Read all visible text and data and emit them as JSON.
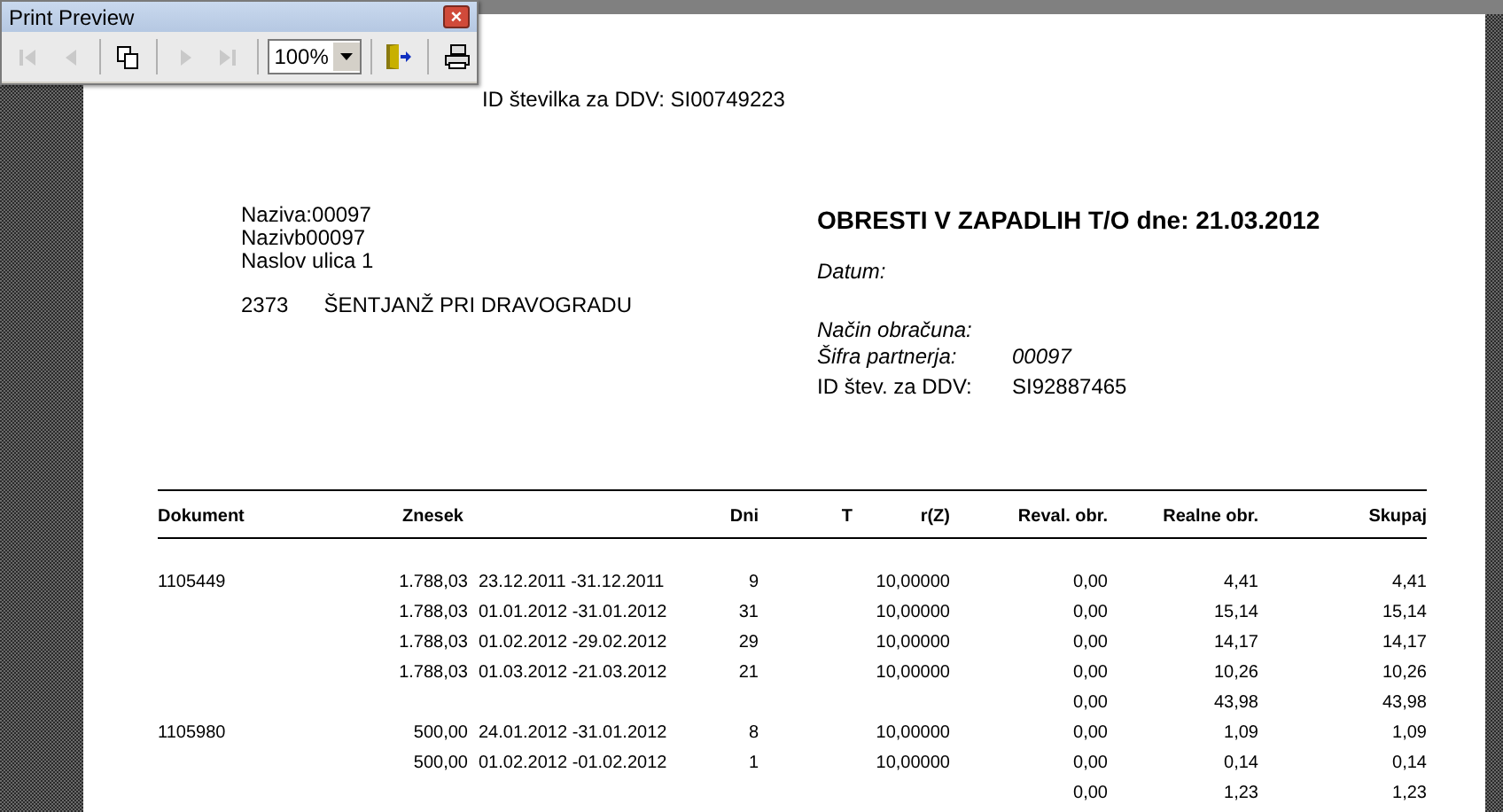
{
  "toolbar_window": {
    "title": "Print Preview",
    "close": "×",
    "tools": [
      {
        "kind": "first",
        "disabled": true
      },
      {
        "kind": "prev",
        "disabled": true
      },
      {
        "kind": "pages",
        "disabled": false
      },
      {
        "kind": "next",
        "disabled": true
      },
      {
        "kind": "last",
        "disabled": true
      },
      {
        "kind": "zoom",
        "value": "100%"
      },
      {
        "kind": "exit",
        "disabled": false
      },
      {
        "kind": "print",
        "disabled": false
      }
    ]
  },
  "report": {
    "id_line": "ID številka za DDV: SI00749223",
    "address": [
      "Naziva:00097",
      "Nazivb00097",
      "Naslov ulica 1"
    ],
    "post_code": "2373",
    "city": "ŠENTJANŽ PRI DRAVOGRADU",
    "title": "OBRESTI V ZAPADLIH T/O dne: 21.03.2012",
    "date_label": "Datum:",
    "method_label": "Način obračuna:",
    "partner_label": "Šifra partnerja:",
    "partner_value": "00097",
    "vat_label": "ID štev. za DDV:",
    "vat_value": "SI92887465"
  },
  "table": {
    "columns": [
      "Dokument",
      "Znesek",
      "",
      "Dni",
      "T",
      "r(Z)",
      "Reval. obr.",
      "Realne obr.",
      "Skupaj"
    ],
    "rows": [
      {
        "cells": [
          "1105449",
          "1.788,03",
          "23.12.2011 -31.12.2011",
          "9",
          "",
          "10,00000",
          "0,00",
          "4,41",
          "4,41"
        ]
      },
      {
        "cells": [
          "",
          "1.788,03",
          "01.01.2012 -31.01.2012",
          "31",
          "",
          "10,00000",
          "0,00",
          "15,14",
          "15,14"
        ]
      },
      {
        "cells": [
          "",
          "1.788,03",
          "01.02.2012 -29.02.2012",
          "29",
          "",
          "10,00000",
          "0,00",
          "14,17",
          "14,17"
        ]
      },
      {
        "cells": [
          "",
          "1.788,03",
          "01.03.2012 -21.03.2012",
          "21",
          "",
          "10,00000",
          "0,00",
          "10,26",
          "10,26"
        ]
      },
      {
        "cells": [
          "",
          "",
          "",
          "",
          "",
          "",
          "0,00",
          "43,98",
          "43,98"
        ]
      },
      {
        "cells": [
          "1105980",
          "500,00",
          "24.01.2012 -31.01.2012",
          "8",
          "",
          "10,00000",
          "0,00",
          "1,09",
          "1,09"
        ]
      },
      {
        "cells": [
          "",
          "500,00",
          "01.02.2012 -01.02.2012",
          "1",
          "",
          "10,00000",
          "0,00",
          "0,14",
          "0,14"
        ]
      },
      {
        "cells": [
          "",
          "",
          "",
          "",
          "",
          "",
          "0,00",
          "1,23",
          "1,23"
        ]
      }
    ]
  }
}
